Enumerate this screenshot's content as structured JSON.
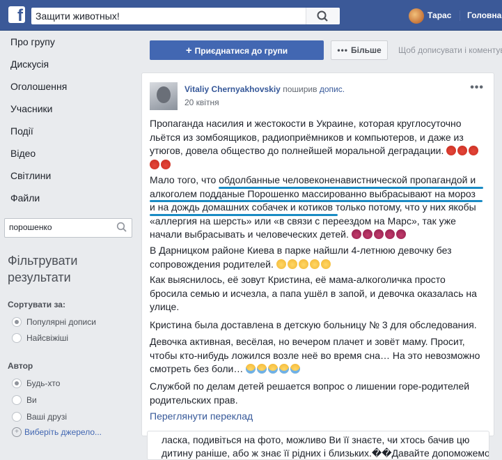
{
  "header": {
    "logo": "f",
    "search_value": "Защити животных!",
    "user_name": "Тарас",
    "home_label": "Головна"
  },
  "sidebar": {
    "items": [
      {
        "label": "Про групу"
      },
      {
        "label": "Дискусія"
      },
      {
        "label": "Оголошення"
      },
      {
        "label": "Учасники"
      },
      {
        "label": "Події"
      },
      {
        "label": "Відео"
      },
      {
        "label": "Світлини"
      },
      {
        "label": "Файли"
      }
    ],
    "search_value": "порошенко",
    "filter_title": "Фільтрувати результати",
    "sort_label": "Сортувати за:",
    "sort_options": [
      {
        "label": "Популярні дописи",
        "selected": true
      },
      {
        "label": "Найсвіжіші",
        "selected": false
      }
    ],
    "author_label": "Автор",
    "author_options": [
      {
        "label": "Будь-хто",
        "selected": true
      },
      {
        "label": "Ви",
        "selected": false
      },
      {
        "label": "Ваші друзі",
        "selected": false
      }
    ],
    "choose_source": "Виберіть джерело..."
  },
  "actions": {
    "join_label": "Приєднатися до групи",
    "more_label": "Більше",
    "hint": "Щоб дописувати і коментувати"
  },
  "post": {
    "author": "Vitaliy Chernyakhovskiy",
    "shared": "поширив",
    "post_word": "допис.",
    "date": "20 квітня",
    "paragraphs": [
      "Пропаганда насилия и жестокости в Украине, которая круглосуточно льётся из зомбоящиков, радиоприёмников и компьютеров, и даже из утюгов, довела общество до полнейшей моральной деградации.",
      "Мало того, что обдолбанные человеконенавистнической пропагандой и алкоголем подданые Порошенко массированно выбрасывают на мороз и на дождь домашних собачек и котиков только потому, что у них якобы «аллергия на шерсть» или «в связи с переездом на Марс», так уже начали выбрасывать и человеческих детей.",
      "В Дарницком районе Киева в парке найшли 4-летнюю девочку без сопровождения родителей.",
      "Как выяснилось, её зовут Кристина, её мама-алкоголичка просто бросила семью и исчезла, а папа ушёл в запой, и девочка оказалась на улице.",
      "Кристина была доставлена в детскую больницу № 3 для обследования.",
      "Девочка активная, весёлая, но вечером плачет и зовёт маму. Просит, чтобы кто-нибудь ложился возле неё во время сна… На это невозможно смотреть без боли…",
      "Службой по делам детей решается вопрос о лишении горе-родителей родительских прав."
    ],
    "translate": "Переглянути переклад"
  },
  "next_post": {
    "line1": "ласка, подивіться на фото, можливо Ви її знаєте, чи хтось бачив цю",
    "line2": "дитину раніше, або ж знає її рідних і близьких.��Давайте допоможемо"
  }
}
